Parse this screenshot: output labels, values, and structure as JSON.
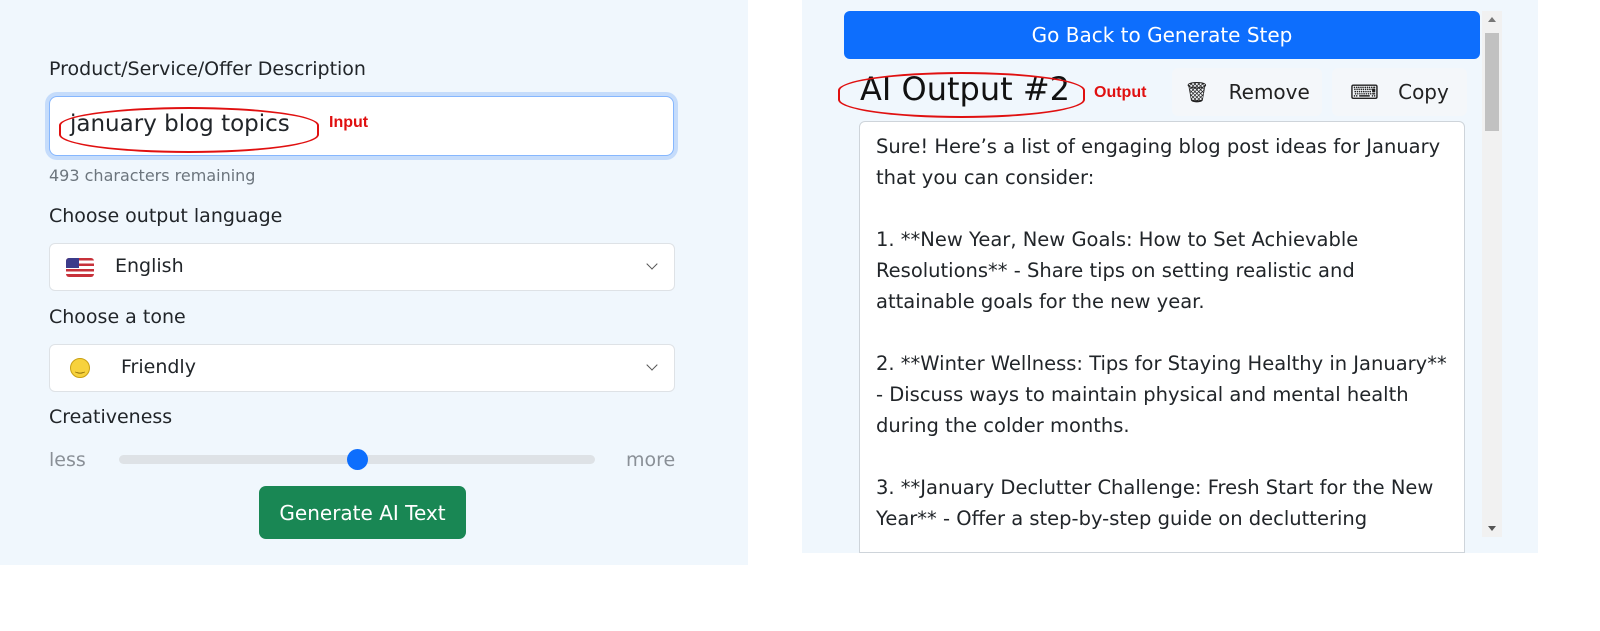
{
  "form": {
    "description_label": "Product/Service/Offer Description",
    "description_value": "january blog topics",
    "input_annotation": "Input",
    "chars_remaining": "493 characters remaining",
    "language_label": "Choose output language",
    "language_value": "English",
    "tone_label": "Choose a tone",
    "tone_value": "Friendly",
    "creativeness_label": "Creativeness",
    "creativeness_min": "less",
    "creativeness_max": "more",
    "creativeness_level": 0.5,
    "generate_button": "Generate AI Text"
  },
  "output": {
    "back_button": "Go Back to Generate Step",
    "title": "AI Output #2",
    "output_annotation": "Output",
    "remove_button": "Remove",
    "copy_button": "Copy",
    "text": "Sure! Here’s a list of engaging blog post ideas for January that you can consider:\n\n1. **New Year, New Goals: How to Set Achievable Resolutions** - Share tips on setting realistic and attainable goals for the new year.\n\n2. **Winter Wellness: Tips for Staying Healthy in January** - Discuss ways to maintain physical and mental health during the colder months.\n\n3. **January Declutter Challenge: Fresh Start for the New Year** - Offer a step-by-step guide on decluttering"
  },
  "colors": {
    "primary": "#0d6efd",
    "success": "#198754",
    "annotation": "#e01010"
  }
}
